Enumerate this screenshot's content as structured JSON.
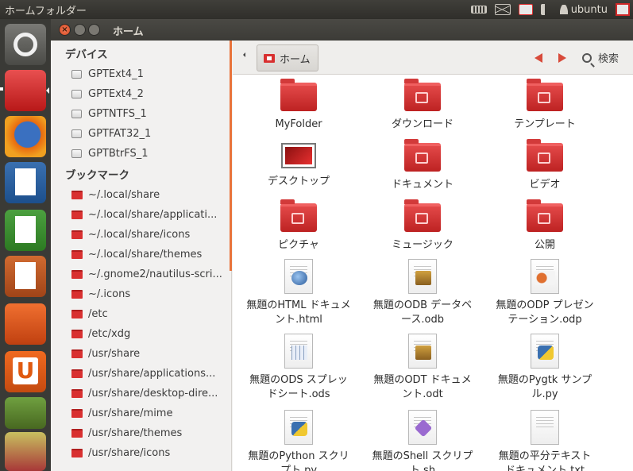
{
  "top_panel": {
    "title": "ホームフォルダー",
    "username": "ubuntu"
  },
  "window": {
    "title": "ホーム",
    "close_glyph": "×"
  },
  "sidebar": {
    "devices_header": "デバイス",
    "devices": [
      "GPTExt4_1",
      "GPTExt4_2",
      "GPTNTFS_1",
      "GPTFAT32_1",
      "GPTBtrFS_1"
    ],
    "bookmarks_header": "ブックマーク",
    "bookmarks": [
      "~/.local/share",
      "~/.local/share/applicati...",
      "~/.local/share/icons",
      "~/.local/share/themes",
      "~/.gnome2/nautilus-scri...",
      "~/.icons",
      "/etc",
      "/etc/xdg",
      "/usr/share",
      "/usr/share/applications...",
      "/usr/share/desktop-dire...",
      "/usr/share/mime",
      "/usr/share/themes",
      "/usr/share/icons"
    ]
  },
  "toolbar": {
    "breadcrumb": "ホーム",
    "search_label": "検索"
  },
  "files": [
    {
      "line1": "MyFolder",
      "line2": "",
      "icon": "folder"
    },
    {
      "line1": "ダウンロード",
      "line2": "",
      "icon": "folder-download"
    },
    {
      "line1": "テンプレート",
      "line2": "",
      "icon": "folder-templates"
    },
    {
      "line1": "デスクトップ",
      "line2": "",
      "icon": "desktop"
    },
    {
      "line1": "ドキュメント",
      "line2": "",
      "icon": "folder-documents"
    },
    {
      "line1": "ビデオ",
      "line2": "",
      "icon": "folder-videos"
    },
    {
      "line1": "ピクチャ",
      "line2": "",
      "icon": "folder-pictures"
    },
    {
      "line1": "ミュージック",
      "line2": "",
      "icon": "folder-music"
    },
    {
      "line1": "公開",
      "line2": "",
      "icon": "folder-public"
    },
    {
      "line1": "無題のHTML ドキュメ",
      "line2": "ント.html",
      "icon": "html-doc"
    },
    {
      "line1": "無題のODB データベ",
      "line2": "ース.odb",
      "icon": "odb-doc"
    },
    {
      "line1": "無題のODP プレゼン",
      "line2": "テーション.odp",
      "icon": "odp-doc"
    },
    {
      "line1": "無題のODS スプレッ",
      "line2": "ドシート.ods",
      "icon": "ods-doc"
    },
    {
      "line1": "無題のODT ドキュメ",
      "line2": "ント.odt",
      "icon": "odt-doc"
    },
    {
      "line1": "無題のPygtk サンプ",
      "line2": "ル.py",
      "icon": "python-doc"
    },
    {
      "line1": "無題のPython スクリ",
      "line2": "プト.py",
      "icon": "python-doc"
    },
    {
      "line1": "無題のShell スクリプ",
      "line2": "ト.sh",
      "icon": "shell-doc"
    },
    {
      "line1": "無題の平分テキスト",
      "line2": "ドキュメント.txt",
      "icon": "text-doc"
    }
  ],
  "colors": {
    "accent": "#e8733a",
    "folder_red": "#d23a3a",
    "panel_dark": "#3c3b37"
  }
}
